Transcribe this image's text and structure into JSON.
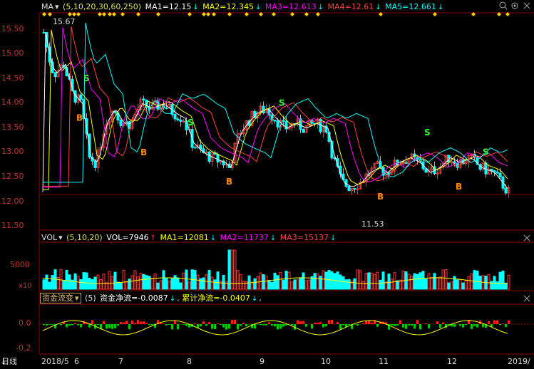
{
  "main": {
    "indicator": "MA",
    "params": "(5,10,20,30,60,250)",
    "ma1": "MA1=12.15",
    "ma2": "MA2=12.345",
    "ma3": "MA3=12.613",
    "ma4": "MA4=12.61",
    "ma5": "MA5=12.661",
    "y_ticks": [
      "15.50",
      "15.00",
      "14.50",
      "14.00",
      "13.50",
      "13.00",
      "12.50",
      "12.00",
      "11.50"
    ],
    "high_label": "15.67",
    "low_label": "11.53",
    "buy_label": "B",
    "sell_label": "S"
  },
  "vol": {
    "indicator": "VOL",
    "params": "(5,10,20)",
    "vol": "VOL=7946",
    "ma1": "MA1=12081",
    "ma2": "MA2=11737",
    "ma3": "MA3=15137",
    "y_tick": "5000",
    "unit": "x10"
  },
  "flow": {
    "indicator": "资金流变",
    "param": "(5)",
    "net": "资金净流=-0.0087",
    "cum": "累计净流=-0.0407",
    "y_ticks": [
      "0.0",
      "-0.2"
    ]
  },
  "bottom": {
    "period": "日线",
    "labels": [
      "2018/5",
      "6",
      "7",
      "8",
      "9",
      "10",
      "11",
      "12",
      "2019/"
    ]
  },
  "colors": {
    "up": "#ff3232",
    "down": "#00ffff",
    "ma1": "#ffffff",
    "ma2": "#ffff00",
    "ma3": "#ff00ff",
    "ma4": "#ff4040",
    "ma5": "#00ffff",
    "grid": "#8b0000"
  }
}
